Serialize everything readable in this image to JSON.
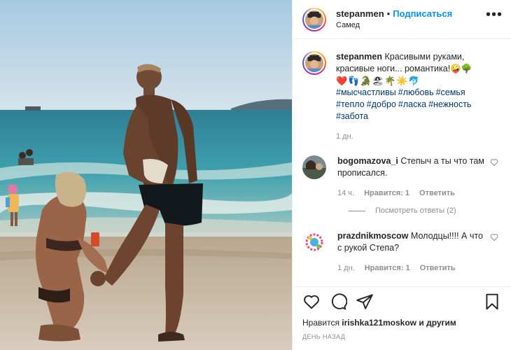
{
  "post": {
    "username": "stepanmen",
    "follow_label": "Подписаться",
    "location": "Самед",
    "more_label": "•••"
  },
  "caption": {
    "username": "stepanmen",
    "text": "Красивыми руками, красивые ноги... романтика!🤪🌳",
    "emojis": "❤️👣🐊🏖🌴☀️🐬",
    "hashtags": [
      "#мысчастливы",
      "#любовь",
      "#семья",
      "#тепло",
      "#добро",
      "#ласка",
      "#нежность",
      "#забота"
    ],
    "time": "1 дн."
  },
  "comments": [
    {
      "username": "bogomazova_i",
      "text": "Степыч а ты что там прописался.",
      "time": "14 ч.",
      "likes": "Нравится: 1",
      "reply": "Ответить",
      "view_replies": "Посмотреть ответы (2)"
    },
    {
      "username": "prazdnikmoscow",
      "text": "Молодцы!!!! А что с рукой Степа?",
      "time": "1 дн.",
      "likes": "Нравится: 1",
      "reply": "Ответить"
    }
  ],
  "likes": {
    "prefix": "Нравится",
    "user": "irishka121moskow",
    "suffix": "и другим"
  },
  "date": "День назад",
  "icons": {
    "like": "heart-icon",
    "comment": "comment-icon",
    "share": "share-icon",
    "save": "bookmark-icon",
    "more": "more-dots-icon"
  },
  "colors": {
    "link": "#0095f6",
    "hashtag": "#00376b",
    "muted": "#8e8e8e"
  }
}
